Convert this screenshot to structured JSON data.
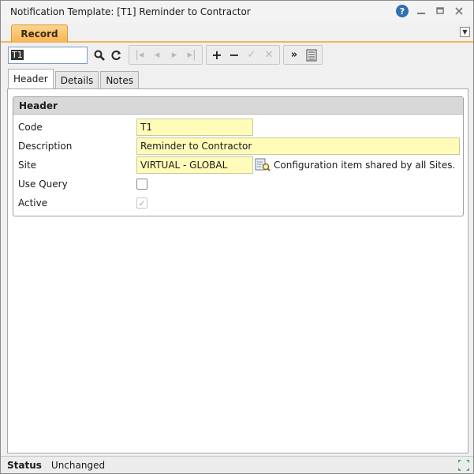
{
  "window": {
    "title": "Notification Template: [T1] Reminder to Contractor"
  },
  "ribbon": {
    "record_tab": "Record"
  },
  "toolbar": {
    "search_value": "T1"
  },
  "tabs": [
    {
      "label": "Header",
      "active": true
    },
    {
      "label": "Details",
      "active": false
    },
    {
      "label": "Notes",
      "active": false
    }
  ],
  "panel": {
    "title": "Header",
    "fields": {
      "code": {
        "label": "Code",
        "value": "T1"
      },
      "description": {
        "label": "Description",
        "value": "Reminder to Contractor"
      },
      "site": {
        "label": "Site",
        "value": "VIRTUAL - GLOBAL",
        "note": "Configuration item shared by all Sites."
      },
      "use_query": {
        "label": "Use Query",
        "checked": false
      },
      "active": {
        "label": "Active",
        "checked": true,
        "disabled": true
      }
    }
  },
  "status": {
    "label": "Status",
    "value": "Unchanged"
  },
  "colors": {
    "field_bg": "#fffbb8",
    "record_tab": "#f7b453",
    "help_icon": "#2f6fb5"
  }
}
